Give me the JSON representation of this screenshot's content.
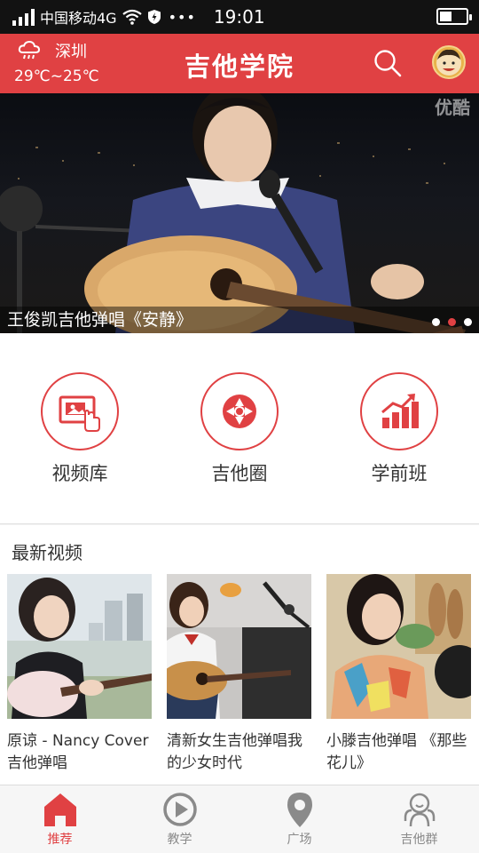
{
  "status_bar": {
    "carrier": "中国移动4G",
    "dots": "•••",
    "time": "19:01"
  },
  "header": {
    "weather_city": "深圳",
    "weather_temp": "29℃~25℃",
    "title": "吉他学院"
  },
  "banner": {
    "watermark": "优酷",
    "caption": "王俊凯吉他弹唱《安静》",
    "slide_count": 3,
    "active_slide": 2
  },
  "quick_nav": [
    {
      "label": "视频库",
      "icon": "video-library-icon"
    },
    {
      "label": "吉他圈",
      "icon": "aperture-icon"
    },
    {
      "label": "学前班",
      "icon": "bar-chart-icon"
    }
  ],
  "latest": {
    "section_title": "最新视频",
    "videos": [
      {
        "title": "原谅 - Nancy Cover吉他弹唱"
      },
      {
        "title": "清新女生吉他弹唱我的少女时代"
      },
      {
        "title": "小滕吉他弹唱 《那些花儿》"
      }
    ]
  },
  "tabs": [
    {
      "label": "推荐",
      "icon": "home-icon",
      "active": true
    },
    {
      "label": "教学",
      "icon": "play-circle-icon",
      "active": false
    },
    {
      "label": "广场",
      "icon": "location-pin-icon",
      "active": false
    },
    {
      "label": "吉他群",
      "icon": "group-icon",
      "active": false
    }
  ],
  "colors": {
    "brand_red": "#e04143",
    "tab_inactive": "#8a8a8a"
  }
}
